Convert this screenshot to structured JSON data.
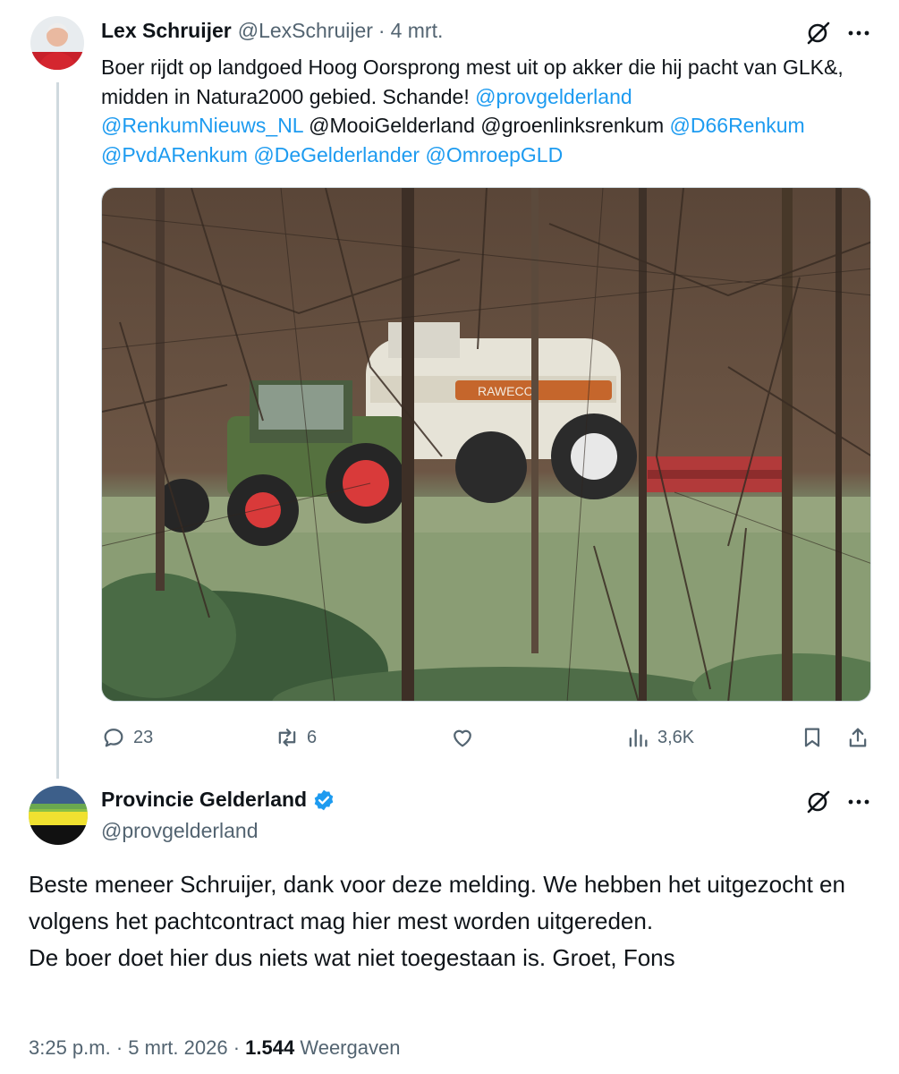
{
  "tweet1": {
    "author_name": "Lex Schruijer",
    "author_handle": "@LexSchruijer",
    "separator": "·",
    "date": "4 mrt.",
    "text_intro": "Boer rijdt op landgoed Hoog Oorsprong mest uit op akker die hij pacht van GLK&, midden in Natura2000 gebied. Schande! ",
    "mentions": [
      "@provgelderland",
      "@RenkumNieuws_NL",
      "@MooiGelderland",
      "@groenlinksrenkum",
      "@D66Renkum",
      "@PvdARenkum",
      "@DeGelderlander",
      "@OmroepGLD"
    ],
    "mention_color": "#1d9bf0",
    "photo_image_text": "RAWECO",
    "actions": {
      "replies": "23",
      "reposts": "6",
      "likes": "",
      "views": "3,6K"
    }
  },
  "tweet2": {
    "author_name": "Provincie Gelderland",
    "author_handle": "@provgelderland",
    "verified_color": "#1d9bf0",
    "text_lines": [
      "Beste meneer Schruijer, dank voor deze melding. We hebben het uitgezocht en volgens het pachtcontract mag hier mest worden uitgereden.",
      "De boer doet hier dus niets wat niet toegestaan is. Groet, Fons"
    ],
    "time": "3:25 p.m.",
    "separator": "·",
    "date": "5 mrt. 2026",
    "views_count": "1.544",
    "views_label": "Weergaven"
  },
  "icons": [
    "grok-icon",
    "more-icon",
    "reply-icon",
    "repost-icon",
    "like-icon",
    "views-icon",
    "bookmark-icon",
    "share-icon",
    "verified-badge-icon"
  ]
}
